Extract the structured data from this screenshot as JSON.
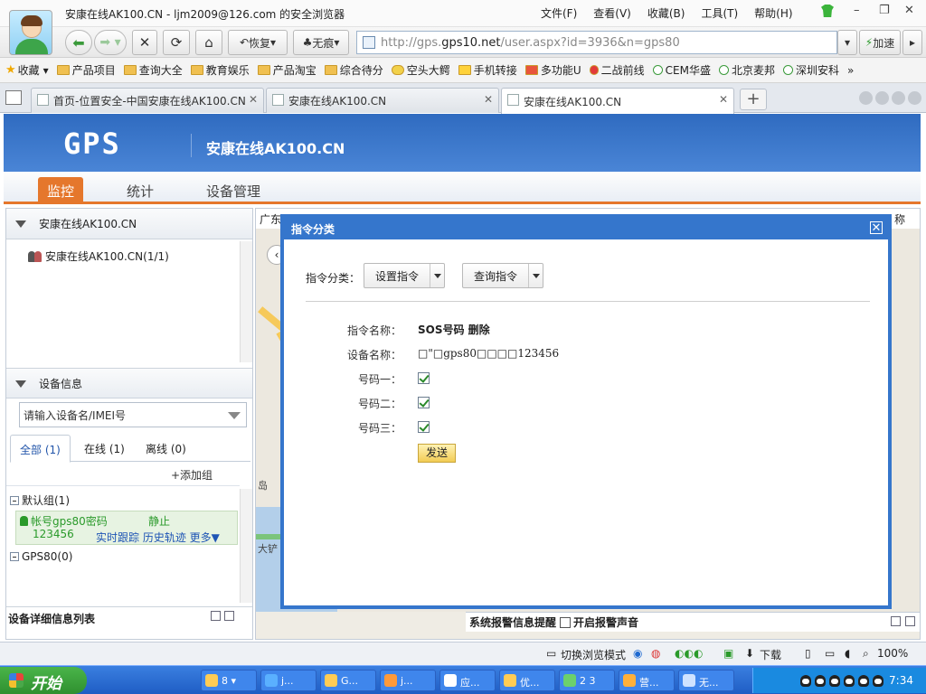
{
  "browser": {
    "window_title": "安康在线AK100.CN - ljm2009@126.com 的安全浏览器",
    "menu": [
      "文件(F)",
      "查看(V)",
      "收藏(B)",
      "工具(T)",
      "帮助(H)"
    ],
    "restore_label": "恢复",
    "traceless_label": "无痕",
    "address_prefix": "http://gps.",
    "address_domain": "gps10.net",
    "address_path": "/user.aspx?id=3936&n=gps80",
    "speedup_label": "加速",
    "bookmarks": [
      "收藏",
      "产品项目",
      "查询大全",
      "教育娱乐",
      "产品淘宝",
      "综合待分",
      "空头大鳄",
      "手机转接",
      "多功能U",
      "二战前线",
      "CEM华盛",
      "北京麦邦",
      "深圳安科"
    ],
    "tabs": [
      {
        "label": "首页-位置安全-中国安康在线AK100.CN"
      },
      {
        "label": "安康在线AK100.CN"
      },
      {
        "label": "安康在线AK100.CN"
      }
    ]
  },
  "header": {
    "logo": "GPS",
    "site_name": "安康在线AK100.CN",
    "nav": [
      "监控",
      "统计",
      "设备管理"
    ]
  },
  "left": {
    "tree_title": "安康在线AK100.CN",
    "tree_item": "安康在线AK100.CN(1/1)",
    "device_info_title": "设备信息",
    "search_placeholder": "请输入设备名/IMEI号",
    "filter_tabs": [
      "全部 (1)",
      "在线 (1)",
      "离线 (0)"
    ],
    "add_group": "+添加组",
    "group_default": "默认组(1)",
    "device_account": "帐号gps80密码",
    "device_password": "123456",
    "device_status": "静止",
    "device_links": "实时跟踪 历史轨迹 更多▼",
    "group_gps80": "GPS80(0)",
    "footer": "设备详细信息列表"
  },
  "map": {
    "top_text": "广东",
    "top_right": "称",
    "alarm_label": "系统报警信息提醒",
    "alarm_sound": "开启报警声音",
    "labels": [
      "岛",
      "大铲"
    ]
  },
  "modal": {
    "title": "指令分类",
    "category_label": "指令分类：",
    "set_command": "设置指令",
    "query_command": "查询指令",
    "fields": [
      {
        "label": "指令名称：",
        "value": "SOS号码 删除"
      },
      {
        "label": "设备名称：",
        "value": "□\"□gps80□□□□123456"
      }
    ],
    "numbers": [
      {
        "label": "号码一：",
        "checked": true
      },
      {
        "label": "号码二：",
        "checked": true
      },
      {
        "label": "号码三：",
        "checked": true
      }
    ],
    "send_label": "发送"
  },
  "statusbar": {
    "switch_mode": "切换浏览模式",
    "download": "下载",
    "zoom": "100%"
  },
  "taskbar": {
    "start": "开始",
    "tasks": [
      "8 ▾",
      "j...",
      "G...",
      "j...",
      "应...",
      "优...",
      "2 3",
      "营...",
      "无..."
    ],
    "clock": "7:34"
  }
}
